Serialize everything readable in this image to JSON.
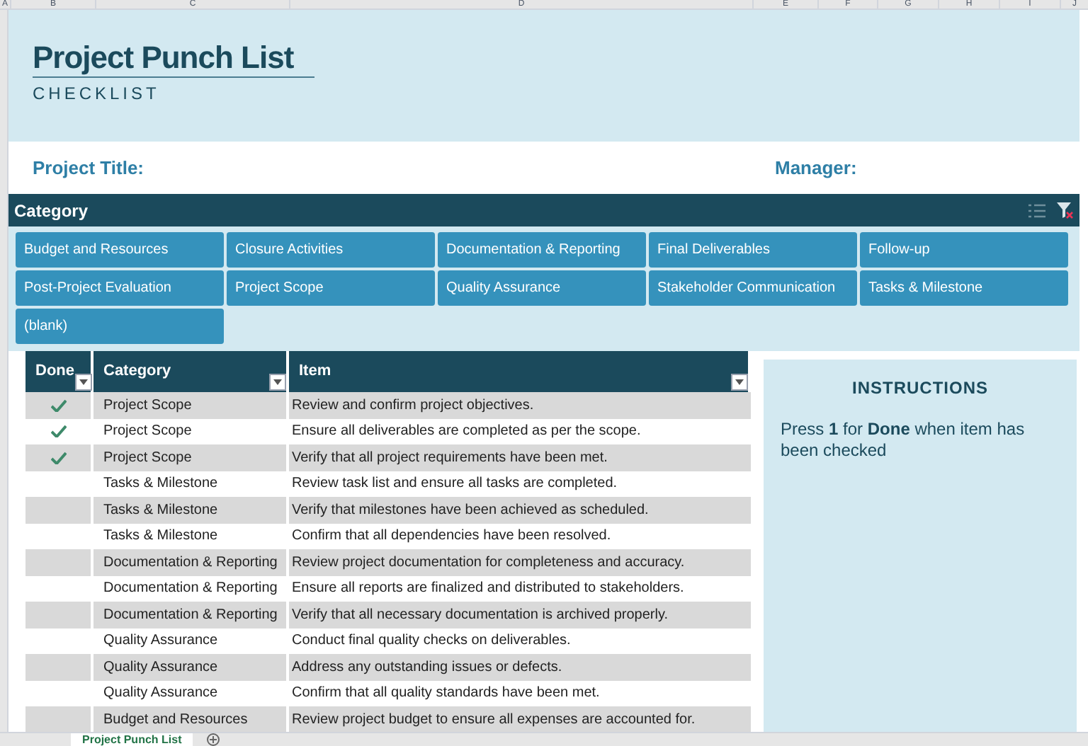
{
  "column_headers": [
    "A",
    "B",
    "C",
    "D",
    "E",
    "F",
    "G",
    "H",
    "I",
    "J"
  ],
  "header": {
    "title": "Project Punch List",
    "subtitle": "CHECKLIST"
  },
  "fields": [
    {
      "label": "Project Title:"
    },
    {
      "label": "Manager:"
    }
  ],
  "slicer": {
    "title": "Category",
    "items": [
      {
        "label": "Budget and Resources",
        "selected": true
      },
      {
        "label": "Closure Activities",
        "selected": true
      },
      {
        "label": "Documentation & Reporting",
        "selected": true
      },
      {
        "label": "Final Deliverables",
        "selected": true
      },
      {
        "label": "Follow-up",
        "selected": true
      },
      {
        "label": "Post-Project Evaluation",
        "selected": true
      },
      {
        "label": "Project Scope",
        "selected": true
      },
      {
        "label": "Quality Assurance",
        "selected": true
      },
      {
        "label": "Stakeholder Communication",
        "selected": true
      },
      {
        "label": "Tasks & Milestone",
        "selected": true
      },
      {
        "label": "(blank)",
        "selected": true
      }
    ]
  },
  "table": {
    "columns": [
      "Done",
      "Category",
      "Item"
    ],
    "rows": [
      {
        "done": true,
        "category": "Project Scope",
        "item": "Review and confirm project objectives."
      },
      {
        "done": true,
        "category": "Project Scope",
        "item": "Ensure all deliverables are completed as per the scope."
      },
      {
        "done": true,
        "category": "Project Scope",
        "item": "Verify that all project requirements have been met."
      },
      {
        "done": false,
        "category": "Tasks & Milestone",
        "item": "Review task list and ensure all tasks are completed."
      },
      {
        "done": false,
        "category": "Tasks & Milestone",
        "item": "Verify that milestones have been achieved as scheduled."
      },
      {
        "done": false,
        "category": "Tasks & Milestone",
        "item": "Confirm that all dependencies have been resolved."
      },
      {
        "done": false,
        "category": "Documentation & Reporting",
        "item": "Review project documentation for completeness and accuracy."
      },
      {
        "done": false,
        "category": "Documentation & Reporting",
        "item": "Ensure all reports are finalized and distributed to stakeholders."
      },
      {
        "done": false,
        "category": "Documentation & Reporting",
        "item": "Verify that all necessary documentation is archived properly."
      },
      {
        "done": false,
        "category": "Quality Assurance",
        "item": "Conduct final quality checks on deliverables."
      },
      {
        "done": false,
        "category": "Quality Assurance",
        "item": "Address any outstanding issues or defects."
      },
      {
        "done": false,
        "category": "Quality Assurance",
        "item": "Confirm that all quality standards have been met."
      },
      {
        "done": false,
        "category": "Budget and Resources",
        "item": "Review project budget to ensure all expenses are accounted for."
      }
    ]
  },
  "instructions": {
    "title": "INSTRUCTIONS",
    "text": "Press **1** for **Done** when item has been checked"
  },
  "sheet_tabs": [
    {
      "label": "Project Punch List",
      "selected": true
    }
  ]
}
